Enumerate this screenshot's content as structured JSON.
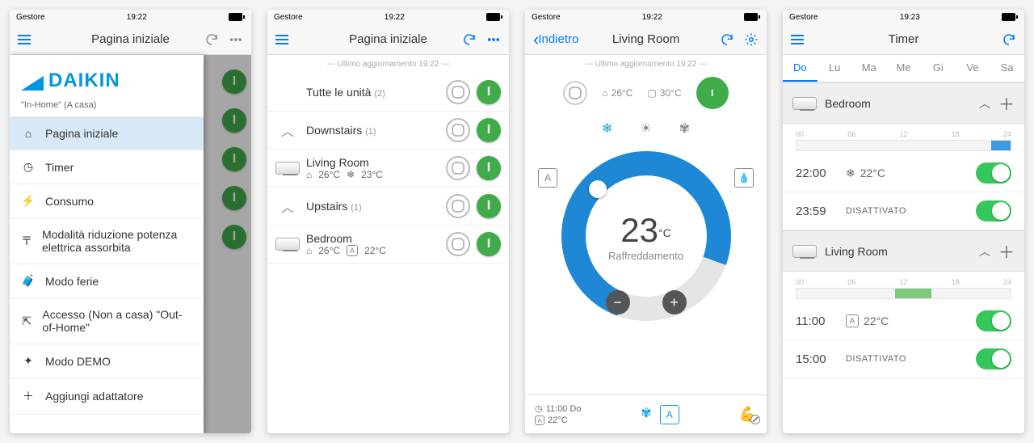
{
  "status": {
    "carrier": "Gestore",
    "time_a": "19:22",
    "time_b": "19:23"
  },
  "nav": {
    "home_title": "Pagina iniziale",
    "room_title": "Living Room",
    "back_label": "Indietro",
    "timer_title": "Timer"
  },
  "update_line": "--- Ultimo aggiornamento 19:22 ---",
  "sidebar": {
    "brand": "DAIKIN",
    "caption": "\"In-Home\" (A casa)",
    "items": [
      {
        "label": "Pagina iniziale"
      },
      {
        "label": "Timer"
      },
      {
        "label": "Consumo"
      },
      {
        "label": "Modalità riduzione potenza elettrica assorbita"
      },
      {
        "label": "Modo ferie"
      },
      {
        "label": "Accesso (Non a casa) \"Out-of-Home\""
      },
      {
        "label": "Modo DEMO"
      },
      {
        "label": "Aggiungi adattatore"
      }
    ]
  },
  "units": {
    "all_label": "Tutte le unità",
    "all_count": "(2)",
    "groups": [
      {
        "label": "Downstairs",
        "count": "(1)"
      },
      {
        "label": "Upstairs",
        "count": "(1)"
      }
    ],
    "rooms": [
      {
        "name": "Living Room",
        "indoor": "26°C",
        "mode_icon": "snow",
        "set": "23°C"
      },
      {
        "name": "Bedroom",
        "indoor": "26°C",
        "mode_icon": "auto",
        "set": "22°C"
      }
    ]
  },
  "thermostat": {
    "indoor": "26°C",
    "outdoor": "30°C",
    "setpoint": "23",
    "unit": "°C",
    "mode_label": "Raffreddamento",
    "schedule_time": "11:00 Do",
    "schedule_set": "22°C"
  },
  "timer": {
    "days": [
      "Do",
      "Lu",
      "Ma",
      "Me",
      "Gi",
      "Ve",
      "Sa"
    ],
    "tick_labels": [
      "00",
      "06",
      "12",
      "18",
      "24"
    ],
    "rooms": [
      {
        "name": "Bedroom",
        "segments": [
          {
            "start_pct": 91,
            "width_pct": 9,
            "color": "#3b9ae1"
          }
        ],
        "entries": [
          {
            "time": "22:00",
            "mode": "snow",
            "value": "22°C"
          },
          {
            "time": "23:59",
            "mode": "off",
            "value": "DISATTIVATO"
          }
        ]
      },
      {
        "name": "Living Room",
        "segments": [
          {
            "start_pct": 46,
            "width_pct": 17,
            "color": "#7cc97c"
          }
        ],
        "entries": [
          {
            "time": "11:00",
            "mode": "auto",
            "value": "22°C"
          },
          {
            "time": "15:00",
            "mode": "off",
            "value": "DISATTIVATO"
          }
        ]
      }
    ]
  }
}
